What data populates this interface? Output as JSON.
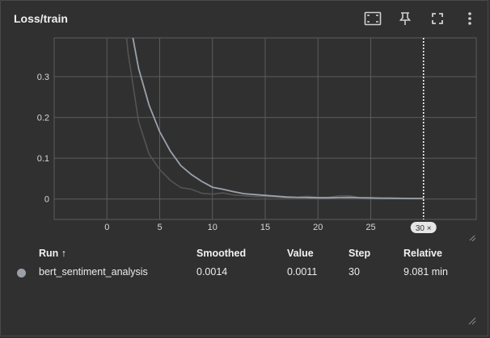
{
  "card": {
    "title": "Loss/train"
  },
  "toolbar": [
    {
      "name": "fit-domain-button",
      "icon": "fit-to-data-icon"
    },
    {
      "name": "pin-button",
      "icon": "pin-icon"
    },
    {
      "name": "fullscreen-button",
      "icon": "fullscreen-icon"
    },
    {
      "name": "more-options-button",
      "icon": "more-vert-icon"
    }
  ],
  "chart_data": {
    "type": "line",
    "title": "Loss/train",
    "xlabel": "",
    "ylabel": "",
    "xlim": [
      -5,
      35
    ],
    "ylim": [
      -0.05,
      0.395
    ],
    "x_ticks": [
      0,
      5,
      10,
      15,
      20,
      25
    ],
    "y_ticks": [
      0,
      0.1,
      0.2,
      0.3
    ],
    "y_tick_labels": [
      "0",
      "0.1",
      "0.2",
      "0.3"
    ],
    "grid": true,
    "hover_step": 30,
    "hover_step_label": "30 ×",
    "colors": {
      "smoothed": "#9ba2ab",
      "raw": "#545454",
      "grid": "#5c5c5c",
      "cursor": "#ffffff"
    },
    "series": [
      {
        "name": "bert_sentiment_analysis",
        "x": [
          1,
          2,
          3,
          4,
          5,
          6,
          7,
          8,
          9,
          10,
          11,
          12,
          13,
          14,
          15,
          16,
          17,
          18,
          19,
          20,
          21,
          22,
          23,
          24,
          25,
          26,
          27,
          28,
          29,
          30
        ],
        "smoothed": [
          0.7,
          0.46,
          0.32,
          0.23,
          0.165,
          0.118,
          0.082,
          0.06,
          0.043,
          0.029,
          0.024,
          0.018,
          0.013,
          0.011,
          0.009,
          0.007,
          0.005,
          0.004,
          0.0035,
          0.003,
          0.003,
          0.0035,
          0.004,
          0.0033,
          0.0028,
          0.0023,
          0.002,
          0.0017,
          0.0015,
          0.0014
        ],
        "raw": [
          0.62,
          0.36,
          0.19,
          0.11,
          0.072,
          0.046,
          0.028,
          0.024,
          0.014,
          0.012,
          0.015,
          0.01,
          0.008,
          0.006,
          0.006,
          0.005,
          0.003,
          0.004,
          0.007,
          0.004,
          0.004,
          0.008,
          0.008,
          0.003,
          0.002,
          0.002,
          0.002,
          0.0015,
          0.0013,
          0.0011
        ]
      }
    ]
  },
  "table": {
    "headers": {
      "run": "Run ↑",
      "smoothed": "Smoothed",
      "value": "Value",
      "step": "Step",
      "relative": "Relative"
    },
    "rows": [
      {
        "run": "bert_sentiment_analysis",
        "smoothed": "0.0014",
        "value": "0.0011",
        "step": "30",
        "relative": "9.081 min",
        "color": "#9aa0a8"
      }
    ]
  }
}
